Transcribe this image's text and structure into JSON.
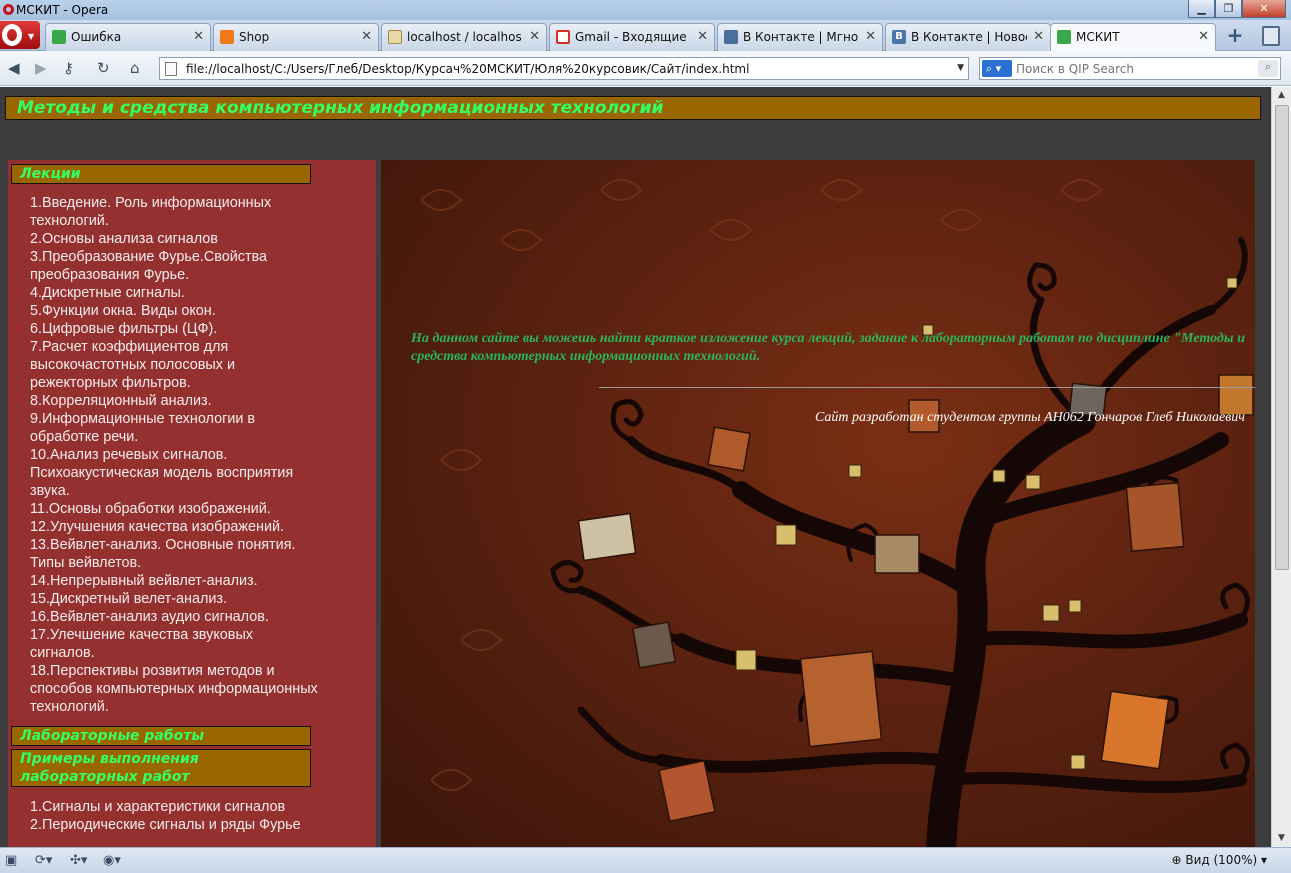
{
  "window": {
    "title": "МСКИТ - Opera"
  },
  "tabs": [
    {
      "label": "Ошибка",
      "icon": "page-icon",
      "color": "#3aa84a"
    },
    {
      "label": "Shop",
      "icon": "shop-icon",
      "color": "#f07a1a"
    },
    {
      "label": "localhost / localhos...",
      "icon": "phpmyadmin-icon",
      "color": "#e8d9a8"
    },
    {
      "label": "Gmail - Входящие (...",
      "icon": "gmail-icon",
      "color": "#d93025"
    },
    {
      "label": "В Контакте | Мгнов...",
      "icon": "message-icon",
      "color": "#4a6f9c"
    },
    {
      "label": "В Контакте | Новос...",
      "icon": "vk-icon",
      "color": "#4a76a8"
    },
    {
      "label": "МСКИТ",
      "icon": "page-icon",
      "color": "#3aa84a"
    }
  ],
  "address": {
    "url": "file://localhost/C:/Users/Глеб/Desktop/Курсач%20МСКИТ/Юля%20курсовик/Сайт/index.html"
  },
  "search": {
    "placeholder": "Поиск в QIP Search"
  },
  "site": {
    "title": "Методы и средства компьютерных информационных технологий",
    "sidebar": {
      "lectures_heading": "Лекции",
      "lectures": [
        "1.Введение. Роль информационных технологий.",
        "2.Основы анализа сигналов",
        "3.Преобразование Фурье.Свойства преобразования Фурье.",
        "4.Дискретные сигналы.",
        "5.Функции окна. Виды окон.",
        "6.Цифровые фильтры (ЦФ).",
        "7.Расчет коэффициентов для высокочастотных полосовых и режекторных фильтров.",
        "8.Корреляционный анализ.",
        "9.Информационные технологии в обработке речи.",
        "10.Анализ речевых сигналов. Психоакустическая модель восприятия звука.",
        "11.Основы обработки изображений.",
        "12.Улучшения качества изображений.",
        "13.Вейвлет-анализ. Основные понятия. Типы вейвлетов.",
        "14.Непрерывный вейвлет-анализ.",
        "15.Дискретный велет-анализ.",
        "16.Вейвлет-анализ аудио сигналов.",
        "17.Улечшение качества звуковых сигналов.",
        "18.Перспективы розвития методов и способов компьютерных информационных технологий."
      ],
      "labs_heading": "Лабораторные работы",
      "examples_heading": "Примеры выполнения лабораторных работ",
      "examples": [
        "1.Сигналы и характеристики сигналов",
        "2.Периодические сигналы и ряды Фурье"
      ]
    },
    "intro": "На данном сайте вы можешь найти краткое изложение курса лекций, задание к лабораторным работам по дисциплине \"Методы и средства компьютерных информационных технологий.",
    "credit": "Сайт разработан студентом группы АН062 Гончаров Глеб Николаевич"
  },
  "statusbar": {
    "zoom": "Вид (100%)"
  },
  "colors": {
    "header_bg": "#996600",
    "header_text": "#33ff66",
    "sidebar_bg": "#943030",
    "intro_text": "#2bb35a"
  }
}
